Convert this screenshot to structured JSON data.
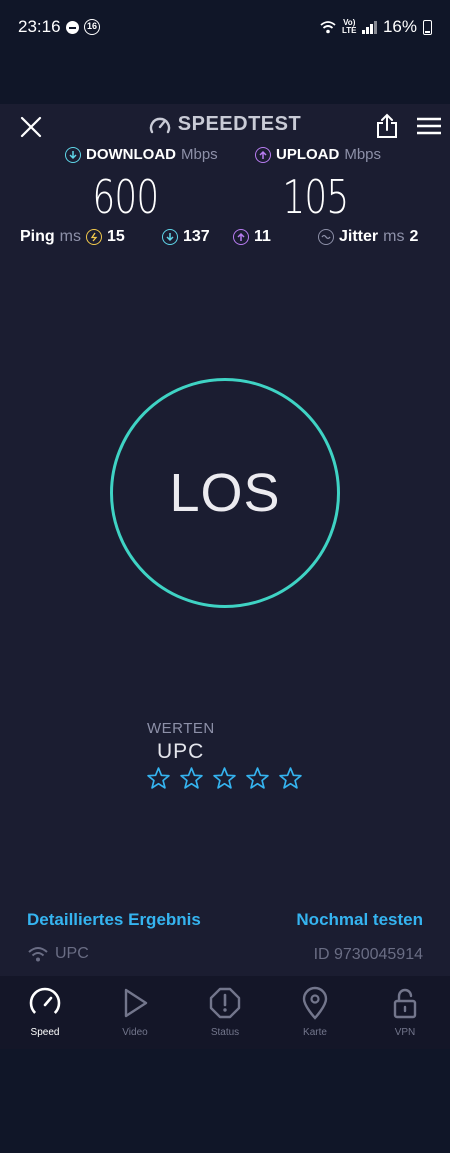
{
  "status_bar": {
    "time": "23:16",
    "notification_badge": "16",
    "volte_label": "Vo)\nLTE",
    "battery": "16%"
  },
  "header": {
    "brand": "SPEEDTEST",
    "close_icon": "close-icon",
    "share_icon": "share-icon",
    "menu_icon": "hamburger-menu-icon"
  },
  "download": {
    "label": "DOWNLOAD",
    "unit": "Mbps",
    "value": "600",
    "color": "#5fd6e8"
  },
  "upload": {
    "label": "UPLOAD",
    "unit": "Mbps",
    "value": "105",
    "color": "#b77cf0"
  },
  "ping": {
    "label": "Ping",
    "unit": "ms",
    "idle": "15",
    "download": "137",
    "upload": "11"
  },
  "jitter": {
    "label": "Jitter",
    "unit": "ms",
    "value": "2"
  },
  "go_button": {
    "label": "LOS",
    "ring_color": "#3fd3c4"
  },
  "rating": {
    "heading": "WERTEN",
    "provider": "UPC",
    "stars": 0,
    "max_stars": 5,
    "star_color": "#35b4f0"
  },
  "actions": {
    "detailed_result": "Detailliertes Ergebnis",
    "test_again": "Nochmal testen"
  },
  "footer": {
    "network": "UPC",
    "result_id": "ID 9730045914"
  },
  "tabs": [
    {
      "label": "Speed",
      "icon": "speedometer-icon",
      "active": true
    },
    {
      "label": "Video",
      "icon": "play-icon",
      "active": false
    },
    {
      "label": "Status",
      "icon": "alert-icon",
      "active": false
    },
    {
      "label": "Karte",
      "icon": "map-pin-icon",
      "active": false
    },
    {
      "label": "VPN",
      "icon": "unlock-icon",
      "active": false
    }
  ]
}
